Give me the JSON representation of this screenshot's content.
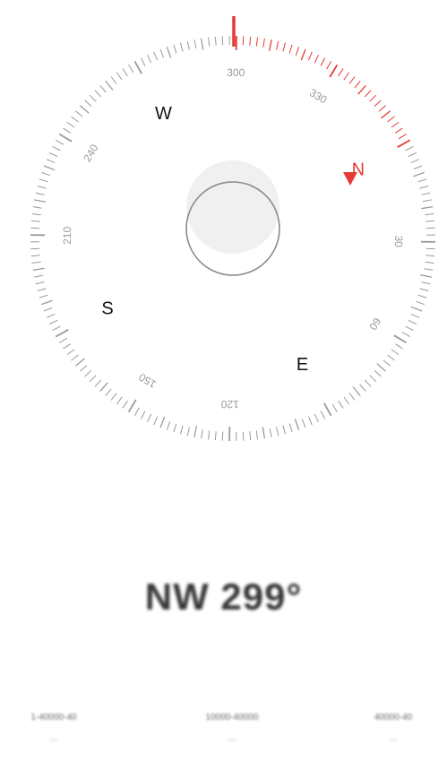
{
  "compass": {
    "heading_degrees": 299,
    "dial_labels": [
      "300",
      "330",
      "30",
      "60",
      "120",
      "150",
      "210",
      "240"
    ],
    "cardinals": [
      "N",
      "E",
      "S",
      "W"
    ],
    "accent_color": "#e53935",
    "tick_color": "#9a9a9a",
    "cardinal_color": "#111111"
  },
  "heading": {
    "text": "NW 299°"
  },
  "coordinates": [
    {
      "value": "1-40000-40",
      "sub": "—"
    },
    {
      "value": "10000-40000",
      "sub": "—"
    },
    {
      "value": "40000-40",
      "sub": "—"
    }
  ]
}
